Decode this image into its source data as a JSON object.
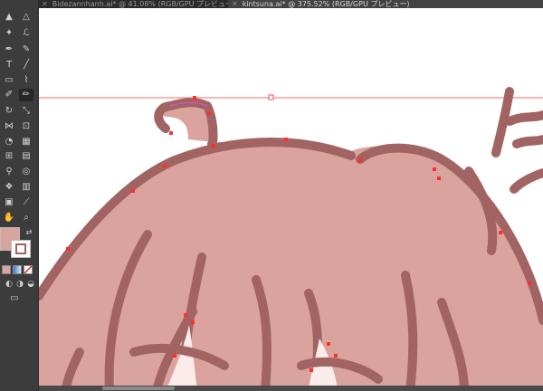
{
  "app": {
    "tabs": [
      {
        "title": "Bidezannhanh.ai* @ 41.08% (RGB/GPU プレビュー)",
        "active": false
      },
      {
        "title": "kintsuna.ai* @ 375.52% (RGB/GPU プレビュー)",
        "active": true
      }
    ]
  },
  "toolbar": {
    "tools": [
      "selection-tool",
      "direct-selection-tool",
      "magic-wand-tool",
      "lasso-tool",
      "pen-tool",
      "curvature-tool",
      "type-tool",
      "line-segment-tool",
      "rectangle-tool",
      "paintbrush-tool",
      "shaper-tool",
      "pencil-tool",
      "rotate-tool",
      "scale-tool",
      "width-tool",
      "free-transform-tool",
      "shape-builder-tool",
      "perspective-grid-tool",
      "mesh-tool",
      "gradient-tool",
      "eyedropper-tool",
      "blend-tool",
      "symbol-sprayer-tool",
      "column-graph-tool",
      "artboard-tool",
      "slice-tool",
      "hand-tool",
      "zoom-tool"
    ],
    "fill_color": "#dba39e",
    "stroke_color": "#a26463"
  },
  "artwork": {
    "fill_color": "#dba39e",
    "stroke_color": "#a26463",
    "guide_color": "#ff4b4b",
    "anchor_color": "#ff2d2d"
  }
}
